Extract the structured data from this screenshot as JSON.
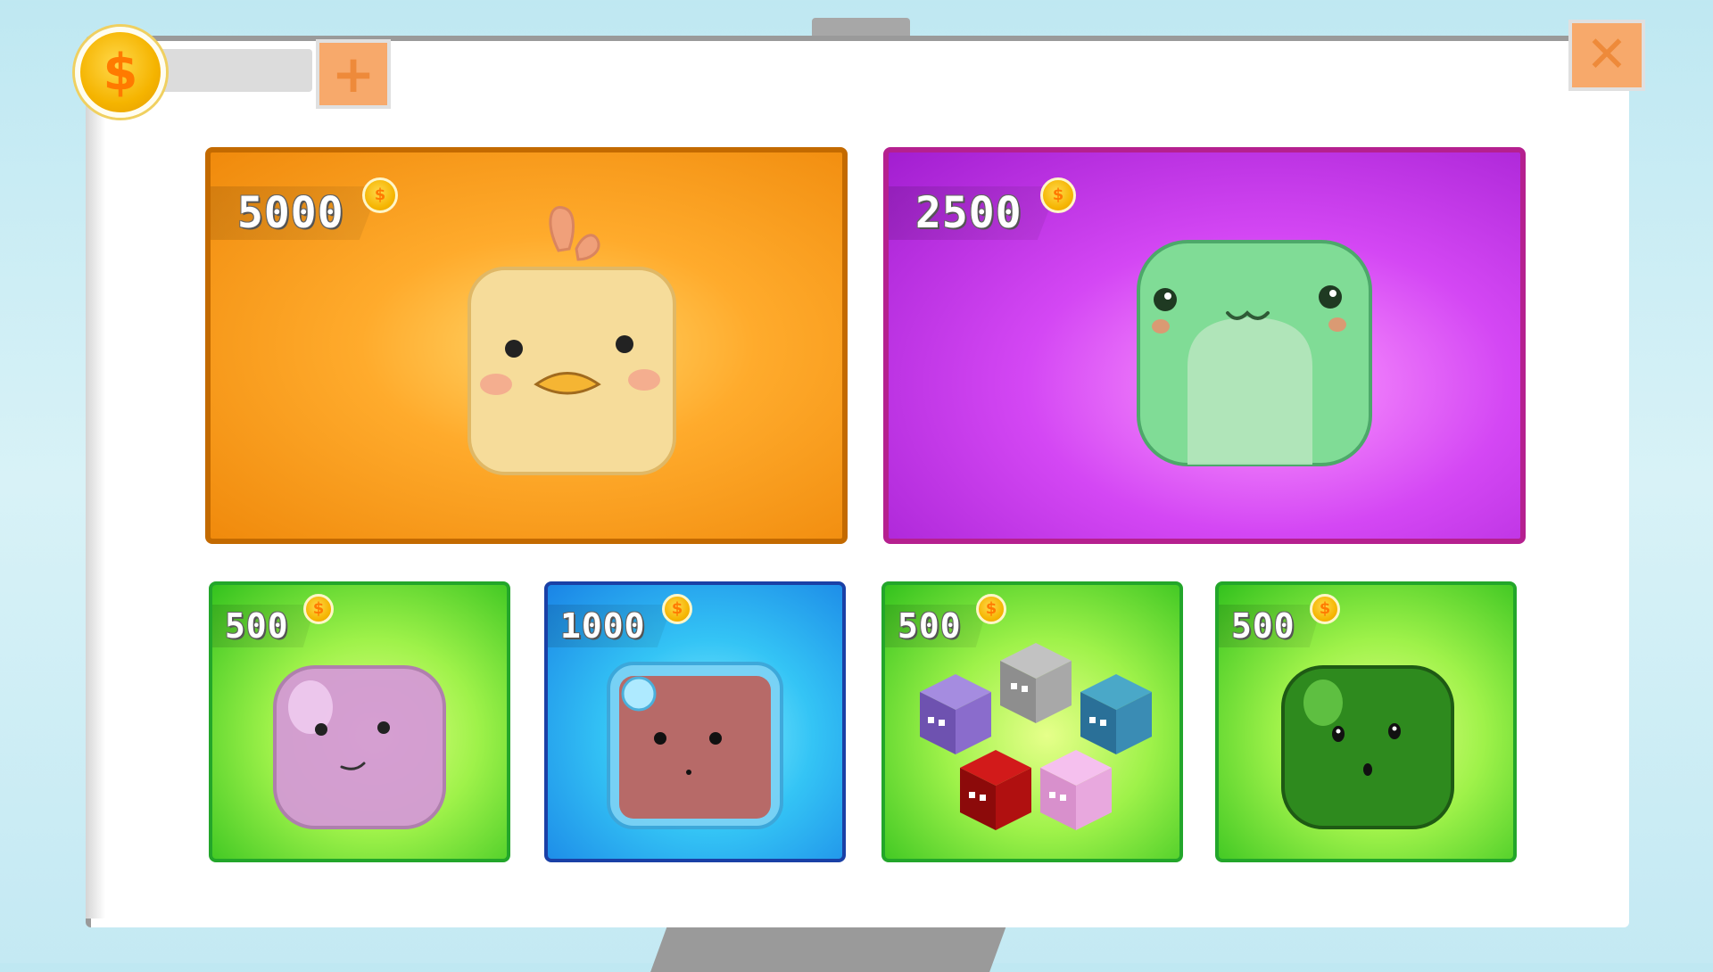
{
  "currency": {
    "balance": "",
    "coin_icon": "dollar-coin-icon",
    "coin_glyph": "$",
    "add_glyph": "+"
  },
  "close": {
    "glyph": "✕"
  },
  "shop_items": [
    {
      "price": "5000",
      "character": "chick-icon",
      "color": "#f39a1a"
    },
    {
      "price": "2500",
      "character": "green-frog-icon",
      "color": "#c93ae8"
    },
    {
      "price": "500",
      "character": "pink-jelly-icon",
      "color": "#7ee23a"
    },
    {
      "price": "1000",
      "character": "red-block-bubble-icon",
      "color": "#2bb5f0"
    },
    {
      "price": "500",
      "character": "cube-pack-icon",
      "color": "#7ee23a"
    },
    {
      "price": "500",
      "character": "green-jelly-icon",
      "color": "#7ee23a"
    }
  ]
}
